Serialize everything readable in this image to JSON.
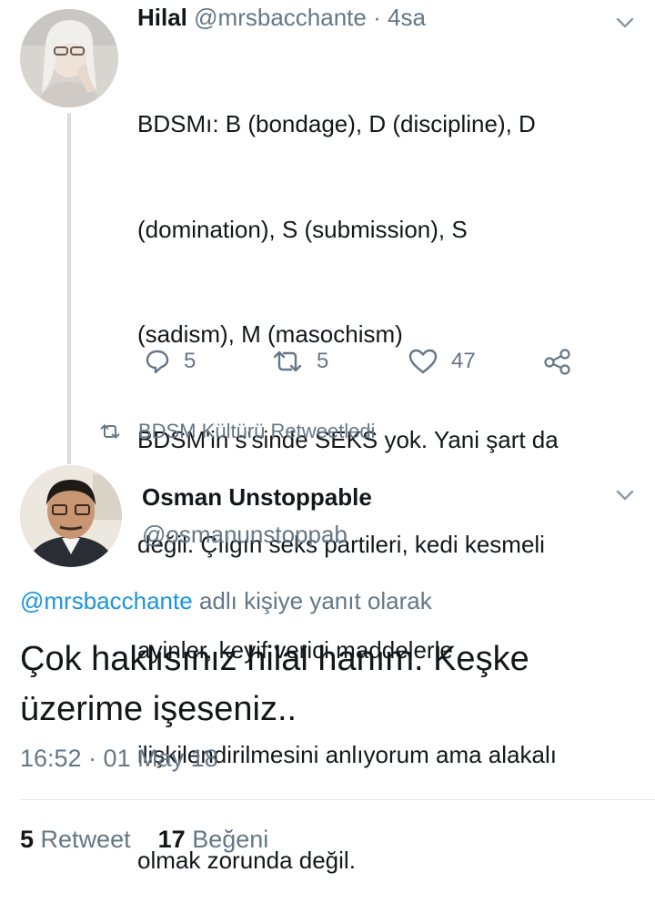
{
  "tweet1": {
    "display_name": "Hilal",
    "handle": "@mrsbacchante",
    "separator": "·",
    "time": "4sa",
    "lines": [
      "BDSMı: B (bondage), D (discipline), D",
      "(domination), S (submission), S",
      "(sadism), M (masochism)",
      "BDSM'in s'sinde SEKS yok. Yani şart da",
      "değil. Çılgın seks partileri, kedi kesmeli",
      "ayinler, keyif verici maddelerle",
      "ilişkilendirilmesini anlıyorum ama alakalı",
      "olmak zorunda değil."
    ],
    "actions": {
      "reply_count": "5",
      "retweet_count": "5",
      "like_count": "47"
    },
    "icons": [
      "chevron-down-icon",
      "reply-icon",
      "retweet-icon",
      "heart-icon",
      "share-icon"
    ]
  },
  "retweeted_by": {
    "text": "BDSM Kültürü Retweetledi",
    "icon": "retweet-icon"
  },
  "tweet2": {
    "display_name": "Osman Unstoppable",
    "handle": "@osmanunstoppab",
    "reply_to_handle": "@mrsbacchante",
    "reply_to_suffix": "adlı kişiye yanıt olarak",
    "text_line1": "Çok haklısınız hilal hanım. Keşke",
    "text_line2": "üzerime işeseniz..",
    "timestamp": "16:52 · 01 May 18",
    "retweet_count": "5",
    "retweet_label": "Retweet",
    "like_count": "17",
    "like_label": "Beğeni"
  },
  "colors": {
    "text": "#14171a",
    "muted": "#657786",
    "link": "#1b95e0",
    "thread_line": "#d7dde2",
    "divider": "#e1e8ed"
  }
}
